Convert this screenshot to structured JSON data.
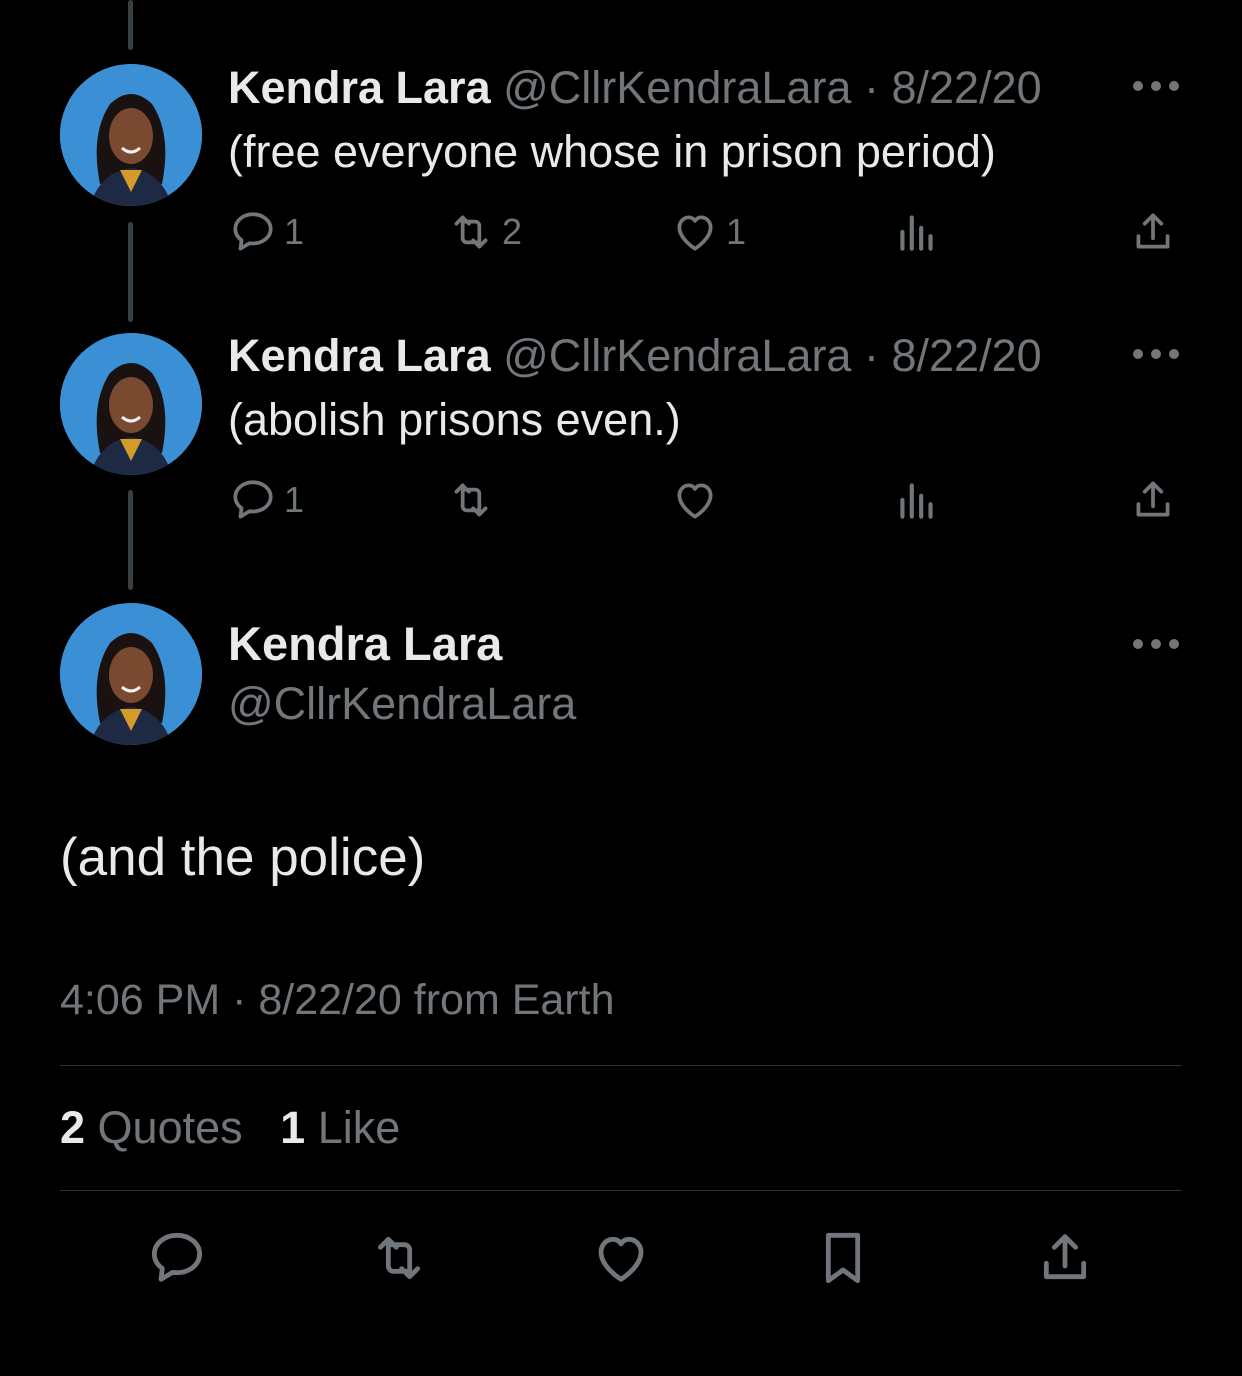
{
  "colors": {
    "background": "#000000",
    "primary_text": "#E7E9EA",
    "secondary_text": "#71767B",
    "divider": "#2F3336",
    "avatar_bg": "#3B8FD4"
  },
  "replies": [
    {
      "name": "Kendra Lara",
      "handle": "@CllrKendraLara",
      "separator": "·",
      "date": "8/22/20",
      "text": "(free everyone whose in prison period)",
      "actions": {
        "reply_count": "1",
        "retweet_count": "2",
        "like_count": "1"
      }
    },
    {
      "name": "Kendra Lara",
      "handle": "@CllrKendraLara",
      "separator": "·",
      "date": "8/22/20",
      "text": "(abolish prisons even.)",
      "actions": {
        "reply_count": "1",
        "retweet_count": "",
        "like_count": ""
      }
    }
  ],
  "main_tweet": {
    "name": "Kendra Lara",
    "handle": "@CllrKendraLara",
    "text": "(and the police)",
    "meta": "4:06 PM · 8/22/20 from Earth",
    "stats": {
      "quotes_count": "2",
      "quotes_label": "Quotes",
      "likes_count": "1",
      "likes_label": "Like"
    }
  },
  "icons": {
    "reply": "speech-bubble-icon",
    "retweet": "retweet-arrows-icon",
    "like": "heart-icon",
    "views": "bar-chart-icon",
    "share": "share-upload-icon",
    "bookmark": "bookmark-icon",
    "more": "three-dots-icon"
  }
}
